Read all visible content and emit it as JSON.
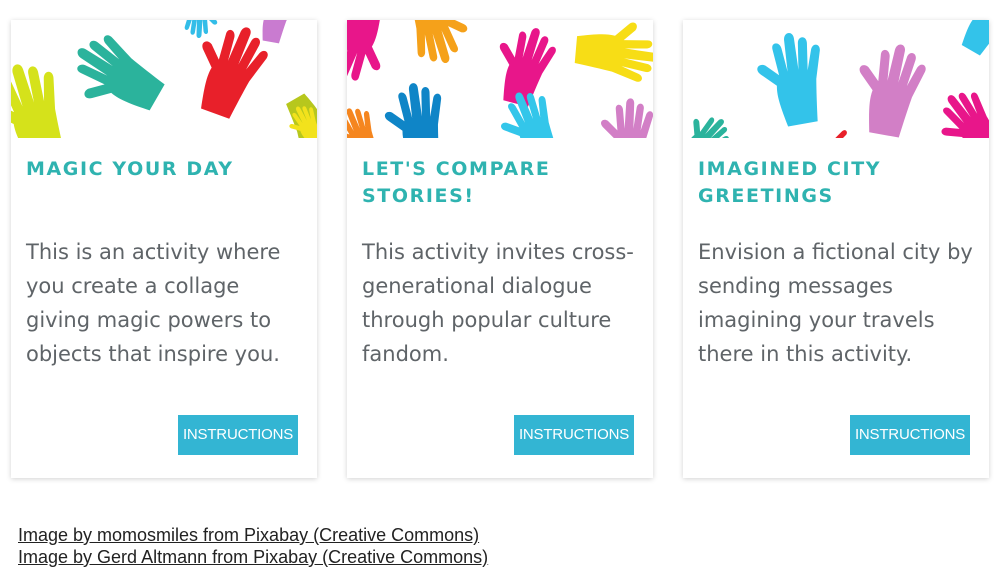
{
  "cards": [
    {
      "title": "MAGIC YOUR DAY",
      "description": "This is an activity where you create a collage giving magic powers to objects that inspire you.",
      "button_label": "INSTRUCTIONS",
      "image_icon": "colorful-hands-image"
    },
    {
      "title": "LET'S COMPARE STORIES!",
      "description": "This activity invites cross-generational dialogue through popular culture fandom.",
      "button_label": "INSTRUCTIONS",
      "image_icon": "colorful-hands-image"
    },
    {
      "title": "IMAGINED CITY GREETINGS",
      "description": "Envision a fictional city by sending messages imagining your travels there in this activity.",
      "button_label": "INSTRUCTIONS",
      "image_icon": "colorful-hands-image"
    }
  ],
  "credits": [
    "Image by momosmiles from Pixabay (Creative Commons)",
    "Image by Gerd Altmann from Pixabay (Creative Commons)"
  ],
  "colors": {
    "title": "#2fb3b0",
    "button": "#33b5d3",
    "text": "#5f6468"
  }
}
